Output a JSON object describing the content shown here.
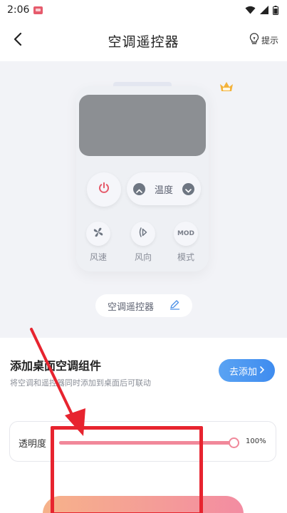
{
  "status_bar": {
    "time": "2:06"
  },
  "header": {
    "title": "空调遥控器",
    "hint_label": "提示"
  },
  "remote": {
    "temperature_label": "温度",
    "functions": [
      {
        "label": "风速",
        "icon": "fan-icon"
      },
      {
        "label": "风向",
        "icon": "wind-direction-icon"
      },
      {
        "label": "模式",
        "icon": "mode-icon",
        "glyph": "MOD"
      }
    ],
    "name": "空调遥控器"
  },
  "widget": {
    "title": "添加桌面空调组件",
    "description": "将空调和遥控器同时添加到桌面后可联动",
    "add_button_label": "去添加",
    "opacity_label": "透明度",
    "opacity_value": "100%",
    "opacity_fraction": 1.0
  },
  "colors": {
    "accent_blue": "#4a94f0",
    "slider_pink": "#f1889a",
    "power_red": "#e55a6a",
    "annotation_red": "#e7242f"
  }
}
